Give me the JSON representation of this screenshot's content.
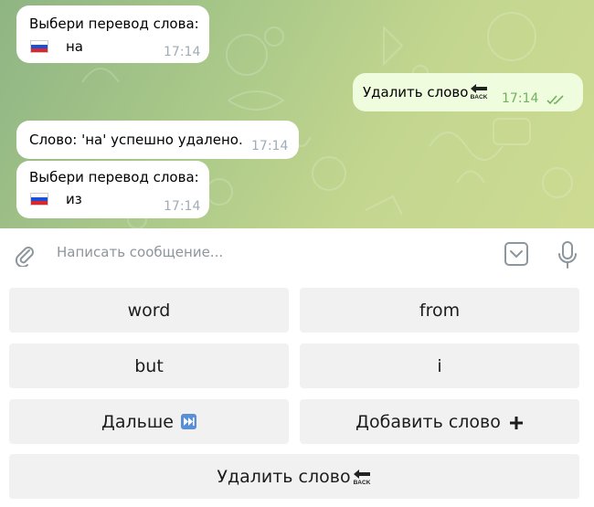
{
  "messages": [
    {
      "text": "Выбери перевод слова:",
      "word": "на",
      "time": "17:14"
    },
    {
      "text": "Удалить слово",
      "time": "17:14"
    },
    {
      "text": "Слово: 'на' успешно удалено.",
      "time": "17:14"
    },
    {
      "text": "Выбери перевод слова:",
      "word": "из",
      "time": "17:14"
    }
  ],
  "composer": {
    "placeholder": "Написать сообщение...",
    "attach_icon": "paperclip-icon",
    "keyboard_icon": "keyboard-toggle-icon",
    "mic_icon": "microphone-icon"
  },
  "keyboard": {
    "row1": [
      "word",
      "from"
    ],
    "row2": [
      "but",
      "i"
    ],
    "next_label": "Дальше",
    "add_label": "Добавить слово",
    "delete_label": "Удалить слово"
  },
  "colors": {
    "incoming_bubble": "#ffffff",
    "outgoing_bubble": "#effdde",
    "read_checks": "#6fb25c",
    "keyboard_button": "#f1f1f1"
  }
}
